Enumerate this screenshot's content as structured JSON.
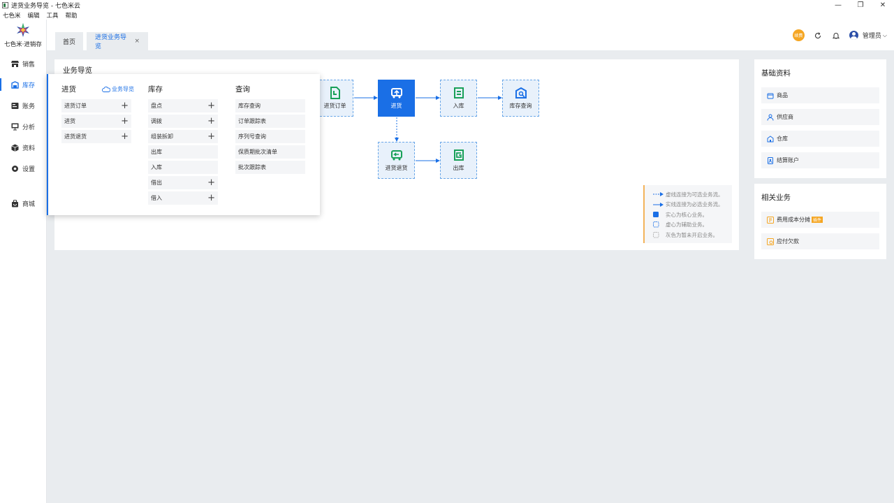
{
  "window": {
    "title": "进货业务导览 - 七色米云",
    "minimize": "—",
    "restore": "❐",
    "close": "✕"
  },
  "menu": [
    "七色米",
    "编辑",
    "工具",
    "帮助"
  ],
  "sidebar": {
    "logo_text": "七色米·进销存",
    "items": [
      {
        "label": "销售",
        "icon": "store-icon"
      },
      {
        "label": "库存",
        "icon": "inventory-icon",
        "active": true
      },
      {
        "label": "账务",
        "icon": "ledger-icon"
      },
      {
        "label": "分析",
        "icon": "chart-icon"
      },
      {
        "label": "资料",
        "icon": "box-icon"
      },
      {
        "label": "设置",
        "icon": "gear-icon"
      },
      {
        "label": "商城",
        "icon": "shop-bag-icon"
      }
    ]
  },
  "tabs": {
    "home": "首页",
    "current": "进货业务导览",
    "close": "×"
  },
  "topbar": {
    "badge": "续费",
    "user": "管理员"
  },
  "main": {
    "title": "业务导览",
    "nodes": [
      {
        "label": "进货订单"
      },
      {
        "label": "进货"
      },
      {
        "label": "入库"
      },
      {
        "label": "库存查询"
      },
      {
        "label": "进货退货"
      },
      {
        "label": "出库"
      }
    ],
    "legend": [
      "虚线连接为可选业务流。",
      "实线连接为必选业务流。",
      "实心为核心业务。",
      "虚心为辅助业务。",
      "灰色为暂未开启业务。"
    ]
  },
  "popup": {
    "col1": {
      "title": "进货",
      "guide": "业务导览",
      "items": [
        {
          "label": "进货订单",
          "plus": true
        },
        {
          "label": "进货",
          "plus": true
        },
        {
          "label": "进货退货",
          "plus": true
        }
      ]
    },
    "col2": {
      "title": "库存",
      "items": [
        {
          "label": "盘点",
          "plus": true
        },
        {
          "label": "调拨",
          "plus": true
        },
        {
          "label": "组装拆卸",
          "plus": true
        },
        {
          "label": "出库",
          "plus": false
        },
        {
          "label": "入库",
          "plus": false
        },
        {
          "label": "借出",
          "plus": true
        },
        {
          "label": "借入",
          "plus": true
        }
      ]
    },
    "col3": {
      "title": "查询",
      "items": [
        {
          "label": "库存查询"
        },
        {
          "label": "订单跟踪表"
        },
        {
          "label": "序列号查询"
        },
        {
          "label": "保质期批次清单"
        },
        {
          "label": "批次跟踪表"
        }
      ]
    }
  },
  "basic": {
    "title": "基础资料",
    "items": [
      "商品",
      "供应商",
      "仓库",
      "结算账户"
    ]
  },
  "related": {
    "title": "相关业务",
    "items": [
      "费用成本分摊",
      "应付欠款"
    ],
    "tag": "插件"
  },
  "colors": {
    "accent": "#1a6fe6",
    "green": "#18a058",
    "orange": "#f5a623"
  }
}
